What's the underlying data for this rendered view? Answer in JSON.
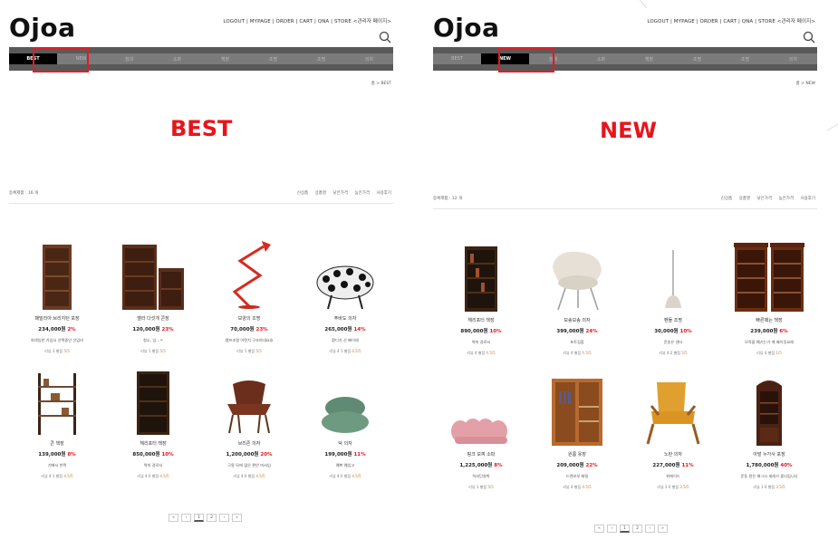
{
  "left": {
    "logo": "Ojoa",
    "toplinks": "LOGOUT | MYPAGE | ORDER | CART | QNA | STORE <관리자 페이지>",
    "nav": [
      "BEST",
      "NEW",
      "침대",
      "소파",
      "책장",
      "조명",
      "조명",
      "의자"
    ],
    "active": 0,
    "breadcrumb": "홈 > BEST",
    "title": "BEST",
    "count": "등록제품 : 16 개",
    "sorts": [
      "신상품",
      "상품명",
      "낮은가격",
      "높은가격",
      "사용후기"
    ],
    "products": [
      {
        "name": "패밀리아 브리지턴 포장",
        "price": "234,000원",
        "disc": "2%",
        "desc": "회색입한 가입서 선택중인 선입비",
        "rev": "리뷰 3 별점 ",
        "score": "5/5"
      },
      {
        "name": "벨라 다섯개 콘장",
        "price": "120,000원",
        "disc": "23%",
        "desc": "청소, 입...ㅋ",
        "rev": "리뷰 1 별점 ",
        "score": "5/5"
      },
      {
        "name": "모양의 조명",
        "price": "70,000원",
        "disc": "23%",
        "desc": "램프조명 어텐치 구조하네요효",
        "rev": "리뷰 1 별점 ",
        "score": "5/5"
      },
      {
        "name": "푸바도 의자",
        "price": "265,000원",
        "disc": "14%",
        "desc": "환디가 산 빠이레",
        "rev": "리뷰 4 1 별점 ",
        "score": "4.5/5"
      },
      {
        "name": "콘 책장",
        "price": "139,000원",
        "disc": "8%",
        "desc": "기뻐서 반짝",
        "rev": "리뷰 4 1 별점 ",
        "score": "4.5/5"
      },
      {
        "name": "헤리포터 책장",
        "price": "850,000원",
        "disc": "10%",
        "desc": "역쉬 걸로서",
        "rev": "리뷰 4 0 별점 ",
        "score": "4.5/5"
      },
      {
        "name": "브리존 의자",
        "price": "1,200,000원",
        "disc": "20%",
        "desc": "구용 뒤에 많은 편안 머서임",
        "rev": "리뷰 4 0 별점 ",
        "score": "4.5/5"
      },
      {
        "name": "덕 의자",
        "price": "199,000원",
        "disc": "11%",
        "desc": "예쁘 예입고",
        "rev": "리뷰 4 0 별점 ",
        "score": "4.5/5"
      }
    ],
    "pager": [
      "«",
      "‹",
      "1",
      "2",
      "›",
      "»"
    ]
  },
  "right": {
    "logo": "Ojoa",
    "toplinks": "LOGOUT | MYPAGE | ORDER | CART | QNA | STORE <관리자 페이지>",
    "nav": [
      "BEST",
      "NEW",
      "침대",
      "소파",
      "책장",
      "조명",
      "조명",
      "의자"
    ],
    "active": 1,
    "breadcrumb": "홈 > NEW",
    "title": "NEW",
    "count": "등록제품 : 12 개",
    "sorts": [
      "신상품",
      "상품명",
      "낮은가격",
      "높은가격",
      "사용후기"
    ],
    "products": [
      {
        "name": "헤리포터 책장",
        "price": "890,000원",
        "disc": "10%",
        "desc": "역쉬 걸로서",
        "rev": "리뷰 4 별점 ",
        "score": "4.5/5"
      },
      {
        "name": "보송보송 의자",
        "price": "399,000원",
        "disc": "24%",
        "desc": "포토집합",
        "rev": "리뷰 4 별점 ",
        "score": "4.5/5"
      },
      {
        "name": "펜둘 조명",
        "price": "30,000원",
        "disc": "10%",
        "desc": "운송은 센터",
        "rev": "리뷰 4 2 별점 ",
        "score": "5/5"
      },
      {
        "name": "빠른때는 책장",
        "price": "239,000원",
        "disc": "6%",
        "desc": "모직을 예기는가 께 페이징요래",
        "rev": "리뷰 4 별점 ",
        "score": "1/5"
      },
      {
        "name": "핑크 모찌 소파",
        "price": "1,225,000원",
        "disc": "8%",
        "desc": "허서단설박",
        "rev": "리뷰 1 별점 ",
        "score": "5/5"
      },
      {
        "name": "원룸 옷장",
        "price": "209,000원",
        "disc": "22%",
        "desc": "드렌보부 채밀",
        "rev": "리뷰 4 별점 ",
        "score": "4.5/5"
      },
      {
        "name": "노란 의자",
        "price": "227,000원",
        "disc": "11%",
        "desc": "위에이드",
        "rev": "리뷰 3 0 별점 ",
        "score": "3.5/5"
      },
      {
        "name": "아발 누가사 포장",
        "price": "1,780,000원",
        "disc": "40%",
        "desc": "운동 왕은 해그시 세레가 좋다립니다",
        "rev": "리뷰 1 0 별점 ",
        "score": "3.5/5"
      }
    ],
    "pager": [
      "«",
      "‹",
      "1",
      "2",
      "›",
      "»"
    ]
  },
  "colors": {
    "accent": "#e8141b",
    "nav": "#595959",
    "active": "#000000",
    "review": "#c87d3a"
  }
}
